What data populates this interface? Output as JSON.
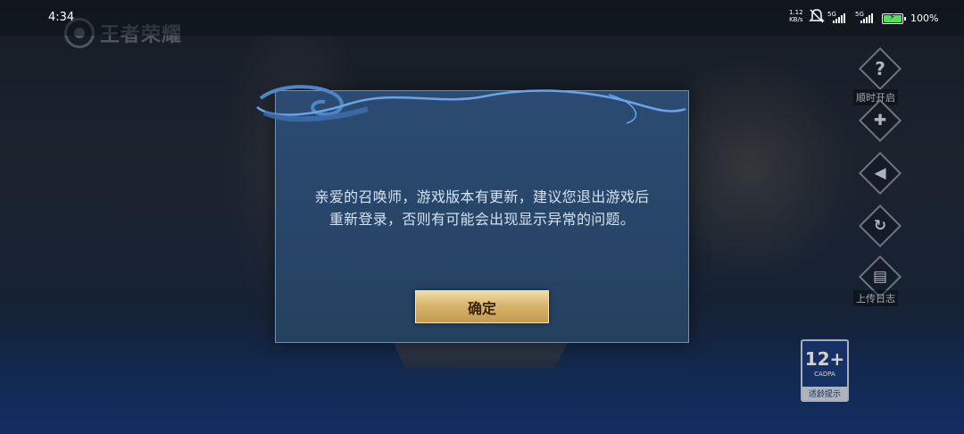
{
  "status_bar": {
    "time": "4:34",
    "net_speed_value": "1.12",
    "net_speed_unit": "KB/s",
    "sim1_label": "5G",
    "sim2_label": "5G",
    "battery_percent": 100,
    "battery_label": "100%",
    "battery_color": "#53e05a"
  },
  "game": {
    "logo_text": "王者荣耀"
  },
  "side_menu": {
    "items": [
      {
        "icon": "question-icon",
        "glyph": "?",
        "label": "顺时开启"
      },
      {
        "icon": "gamepad-icon",
        "glyph": "✚",
        "label": ""
      },
      {
        "icon": "speaker-icon",
        "glyph": "◀",
        "label": ""
      },
      {
        "icon": "refresh-icon",
        "glyph": "↻",
        "label": ""
      },
      {
        "icon": "clipboard-icon",
        "glyph": "▤",
        "label": "上传日志"
      }
    ]
  },
  "age_rating": {
    "number": "12+",
    "org": "CADPA",
    "tip": "适龄提示"
  },
  "dialog": {
    "message_line1": "亲爱的召唤师，游戏版本有更新，建议您退出游戏后",
    "message_line2": "重新登录，否则有可能会出现显示异常的问题。",
    "confirm_label": "确定"
  },
  "colors": {
    "dialog_bg": "#2c4b72",
    "dialog_border": "#6f8fb5",
    "button_gold": "#d8b66e",
    "text_light_blue": "#d3e1f2"
  }
}
